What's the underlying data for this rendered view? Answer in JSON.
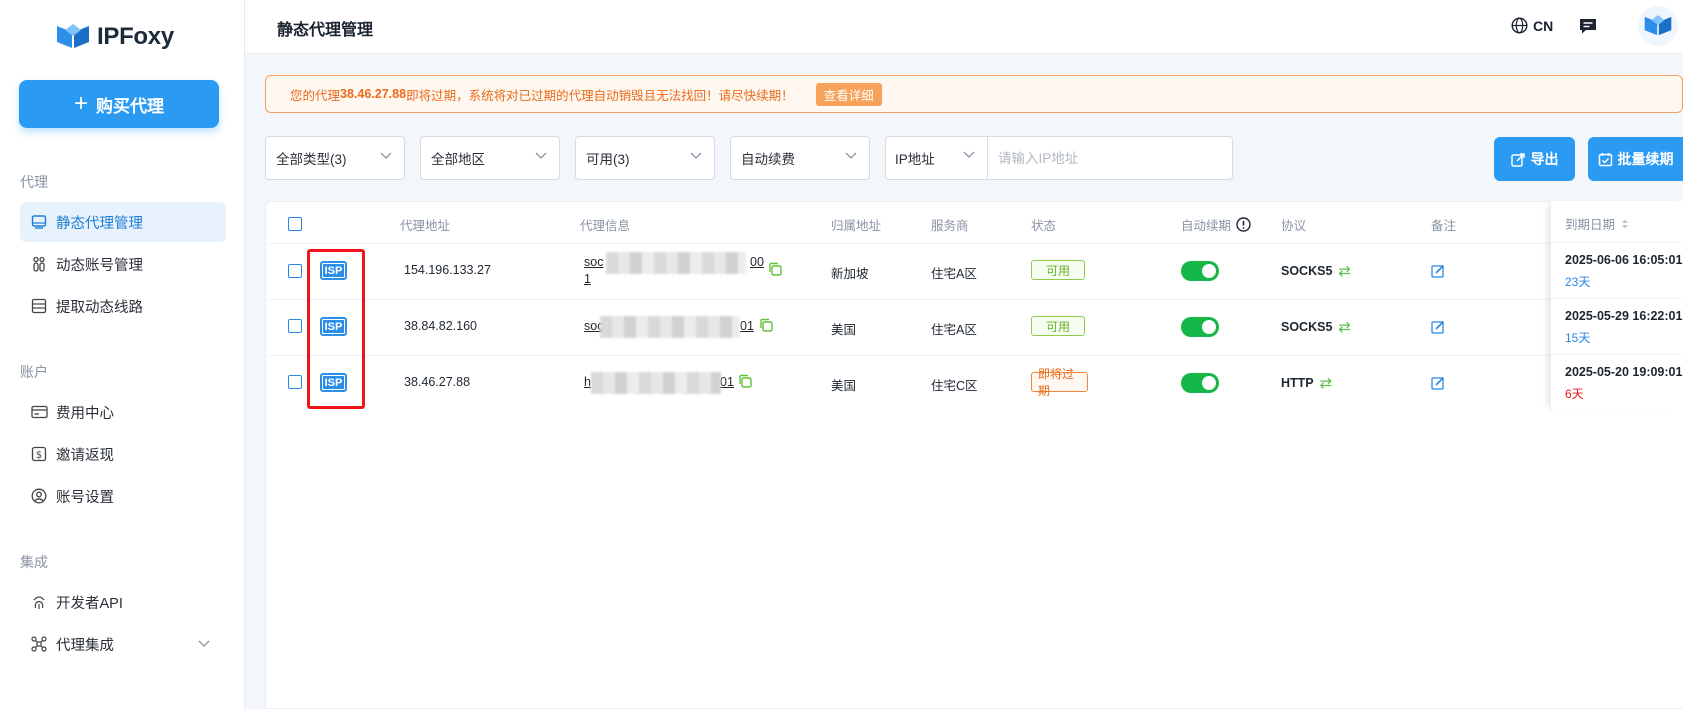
{
  "sidebar": {
    "logo_text": "IPFoxy",
    "buy_button": "购买代理",
    "sections": [
      {
        "label": "代理"
      },
      {
        "label": "账户"
      },
      {
        "label": "集成"
      }
    ],
    "items": [
      {
        "label": "静态代理管理",
        "icon": "monitor-icon",
        "active": true
      },
      {
        "label": "动态账号管理",
        "icon": "people-icon"
      },
      {
        "label": "提取动态线路",
        "icon": "server-icon"
      },
      {
        "label": "费用中心",
        "icon": "card-icon"
      },
      {
        "label": "邀请返现",
        "icon": "dollar-icon"
      },
      {
        "label": "账号设置",
        "icon": "user-icon"
      },
      {
        "label": "开发者API",
        "icon": "fingerprint-icon"
      },
      {
        "label": "代理集成",
        "icon": "network-icon"
      }
    ]
  },
  "header": {
    "title": "静态代理管理",
    "language": "CN"
  },
  "warning": {
    "prefix": "您的代理",
    "ip": "38.46.27.88",
    "suffix": " 即将过期，系统将对已过期的代理自动销毁且无法找回！请尽快续期！",
    "button": "查看详细"
  },
  "filters": {
    "type": "全部类型(3)",
    "region": "全部地区",
    "status": "可用(3)",
    "renew": "自动续费",
    "ip_select": "IP地址",
    "ip_placeholder": "请输入IP地址",
    "export_button": "导出",
    "batch_renew_button": "批量续期"
  },
  "table": {
    "columns": {
      "address": "代理地址",
      "info": "代理信息",
      "location": "归属地址",
      "provider": "服务商",
      "status": "状态",
      "auto_renew": "自动续期",
      "protocol": "协议",
      "note": "备注",
      "expiry": "到期日期"
    },
    "rows": [
      {
        "type": "ISP",
        "address": "154.196.133.27",
        "info_start": "soc",
        "info_end": "00",
        "info_line2": "1",
        "location": "新加坡",
        "provider": "住宅A区",
        "status": "可用",
        "status_kind": "ok",
        "protocol": "SOCKS5",
        "expiry": "2025-06-06 16:05:01",
        "days": "23天",
        "days_color": "#2b86e6"
      },
      {
        "type": "ISP",
        "address": "38.84.82.160",
        "info_start": "soc",
        "info_end": "01",
        "location": "美国",
        "provider": "住宅A区",
        "status": "可用",
        "status_kind": "ok",
        "protocol": "SOCKS5",
        "expiry": "2025-05-29 16:22:01",
        "days": "15天",
        "days_color": "#2b86e6"
      },
      {
        "type": "ISP",
        "address": "38.46.27.88",
        "info_start": "h",
        "info_end": "01",
        "location": "美国",
        "provider": "住宅C区",
        "status": "即将过期",
        "status_kind": "exp",
        "protocol": "HTTP",
        "expiry": "2025-05-20 19:09:01",
        "days": "6天",
        "days_color": "#f0141a"
      }
    ]
  },
  "colors": {
    "brand": "#2b9af3",
    "warning": "#ec6a1a",
    "toggle_on": "#14b848",
    "highlight_box": "#f0141a"
  }
}
